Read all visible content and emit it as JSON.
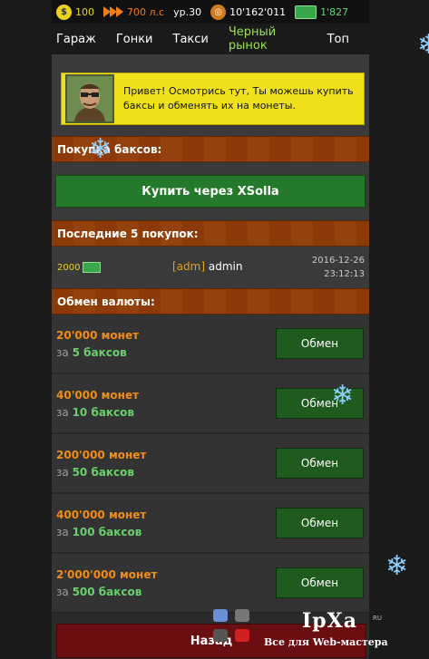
{
  "status": {
    "gold": "100",
    "power": "700 л.с",
    "level": "ур.30",
    "coins": "10'162'011",
    "cash": "1'827"
  },
  "nav": {
    "tabs": [
      "Гараж",
      "Гонки",
      "Такси",
      "Черный рынок",
      "Топ"
    ],
    "active": "Черный рынок"
  },
  "npc": {
    "line1": "Привет! Осмотрись тут, Ты можешь купить",
    "line2": "баксы и обменять их на монеты."
  },
  "buy": {
    "header": "Покупка баксов:",
    "button": "Купить через XSolla"
  },
  "last": {
    "header": "Последние 5 покупок:",
    "amount": "2000",
    "tag": "[adm]",
    "user": "admin",
    "date": "2016-12-26",
    "time": "23:12:13"
  },
  "exchange": {
    "header": "Обмен валюты:",
    "button_label": "Обмен",
    "offers": [
      {
        "coins": "20'000 монет",
        "pre": "за",
        "bucks": "5 баксов"
      },
      {
        "coins": "40'000 монет",
        "pre": "за",
        "bucks": "10 баксов"
      },
      {
        "coins": "200'000 монет",
        "pre": "за",
        "bucks": "50 баксов"
      },
      {
        "coins": "400'000 монет",
        "pre": "за",
        "bucks": "100 баксов"
      },
      {
        "coins": "2'000'000 монет",
        "pre": "за",
        "bucks": "500 баксов"
      }
    ]
  },
  "bottom_button": "Назад",
  "watermark": {
    "logo": "IpXa",
    "ru": "RU",
    "sub": "Все для Web-мастера"
  },
  "colors": {
    "header_brown": "#8b3a08",
    "green_button": "#247a2a",
    "npc_yellow": "#f0e01a",
    "active_tab": "#9ce24c"
  }
}
